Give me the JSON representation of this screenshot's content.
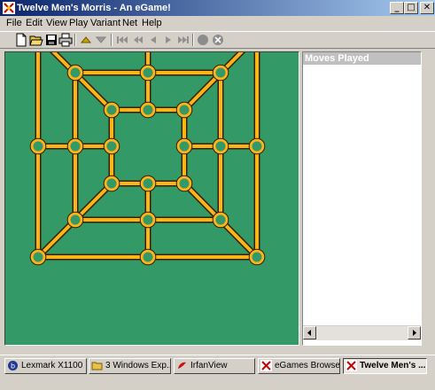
{
  "window": {
    "title": "Twelve Men's Morris - An eGame!",
    "min_glyph": "_",
    "max_glyph": "□",
    "close_glyph": "✕"
  },
  "menu": {
    "items": [
      {
        "label": "File"
      },
      {
        "label": "Edit"
      },
      {
        "label": "View"
      },
      {
        "label": "Play"
      },
      {
        "label": "Variant"
      },
      {
        "label": "Net"
      },
      {
        "label": "Help"
      }
    ]
  },
  "toolbar": {
    "icons": [
      "new-file-icon",
      "open-folder-icon",
      "save-icon",
      "print-icon",
      "move-up-icon",
      "move-down-icon",
      "rewind-start-icon",
      "step-back-icon",
      "step-back-single-icon",
      "step-forward-single-icon",
      "fast-forward-end-icon",
      "stop-icon",
      "cancel-icon"
    ]
  },
  "board": {
    "background": "#339966",
    "line_color": "#ffb31a",
    "line_outline": "#332200",
    "point_fill": "#339966"
  },
  "moves": {
    "header": "Moves Played"
  },
  "taskbar": {
    "items": [
      {
        "label": "Lexmark X1100 ...",
        "icon": "lexmark-icon",
        "active": false
      },
      {
        "label": "3 Windows Exp...",
        "icon": "folder-icon",
        "active": false
      },
      {
        "label": "IrfanView",
        "icon": "irfanview-icon",
        "active": false
      },
      {
        "label": "eGames Browser...",
        "icon": "egames-icon",
        "active": false
      },
      {
        "label": "Twelve Men's ...",
        "icon": "egames-icon",
        "active": true
      }
    ]
  }
}
